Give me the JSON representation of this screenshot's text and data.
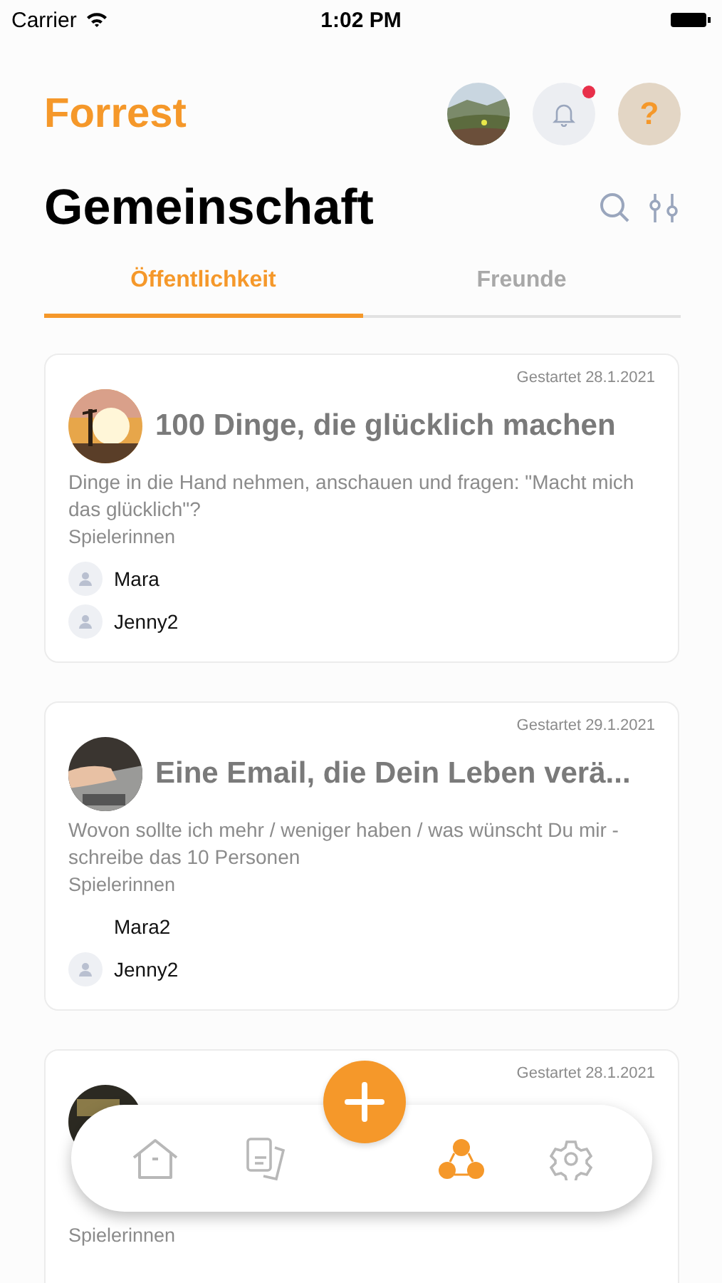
{
  "status_bar": {
    "carrier": "Carrier",
    "time": "1:02 PM"
  },
  "header": {
    "app_name": "Forrest",
    "notification": true,
    "help": "?"
  },
  "title": "Gemeinschaft",
  "tabs": [
    {
      "label": "Öffentlichkeit",
      "selected": true
    },
    {
      "label": "Freunde",
      "selected": false
    }
  ],
  "games": [
    {
      "started": "Gestartet 28.1.2021",
      "kind": "picture",
      "title": "100 Dinge, die glücklich machen",
      "description": "Dinge in die Hand nehmen, anschauen und fragen: \"Macht mich das glücklich\"?",
      "players_label": "Spielerinnen",
      "players": [
        {
          "name": "Mara",
          "avatar": true
        },
        {
          "name": "Jenny2",
          "avatar": true
        }
      ]
    },
    {
      "started": "Gestartet 29.1.2021",
      "kind": "picture",
      "title": "Eine Email, die Dein Leben verä...",
      "description": "Wovon sollte ich mehr / weniger haben / was wünscht Du mir - schreibe das 10 Personen",
      "players_label": "Spielerinnen",
      "players": [
        {
          "name": "Mara2",
          "avatar": false
        },
        {
          "name": "Jenny2",
          "avatar": true
        }
      ]
    },
    {
      "started": "Gestartet 28.1.2021",
      "kind": "picture",
      "players_label": "Spielerinnen"
    }
  ],
  "nav": [
    {
      "kind": "home",
      "selected": false
    },
    {
      "kind": "cards",
      "selected": false
    },
    {
      "kind": "community",
      "selected": true
    },
    {
      "kind": "settings",
      "selected": false
    }
  ]
}
